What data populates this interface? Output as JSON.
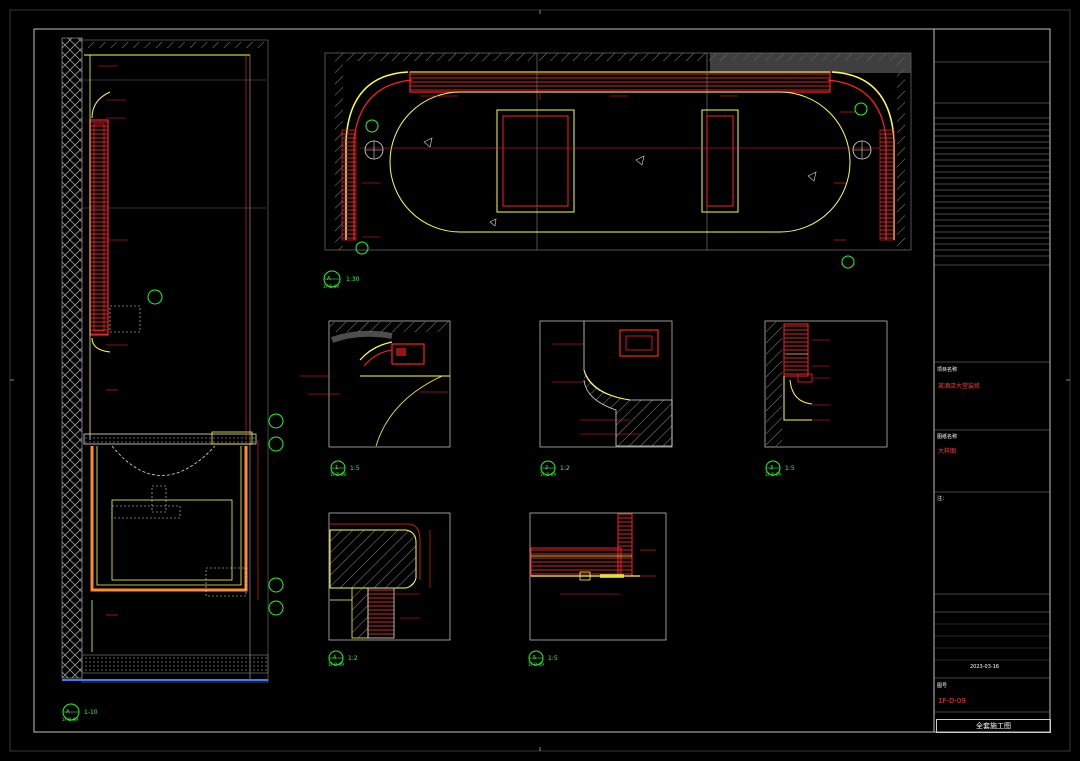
{
  "views": {
    "view1": {
      "tag": "A",
      "sheet": "1F-D-09",
      "caption": "1-10"
    },
    "view2": {
      "tag": "A",
      "sheet": "1F-D-09",
      "caption": "1:30"
    },
    "detail1": {
      "tag": "1",
      "sheet": "1F-D-09",
      "caption": "1:5"
    },
    "detail2": {
      "tag": "2",
      "sheet": "1F-D-09",
      "caption": "1:2"
    },
    "detail3": {
      "tag": "3",
      "sheet": "1F-D-09",
      "caption": "1:5"
    },
    "detail4": {
      "tag": "4",
      "sheet": "1F-D-09",
      "caption": "1:2"
    },
    "detail5": {
      "tag": "5",
      "sheet": "1F-D-09",
      "caption": "1:5"
    }
  },
  "title_block": {
    "date": "2023-03-16",
    "drawing_no": "1F-D-09",
    "bottom_title": "全套施工图",
    "project_label": "项目名称",
    "project_name": "某酒店大堂装修",
    "drawing_label": "图纸名称",
    "drawing_name": "大样图",
    "notes_label": "注：",
    "sheet_label": "图号"
  },
  "colors": {
    "red": "#ff2020",
    "yellow": "#ffff40",
    "green": "#20ff20",
    "gray": "#7a7a7a",
    "white": "#e6e6e6"
  }
}
